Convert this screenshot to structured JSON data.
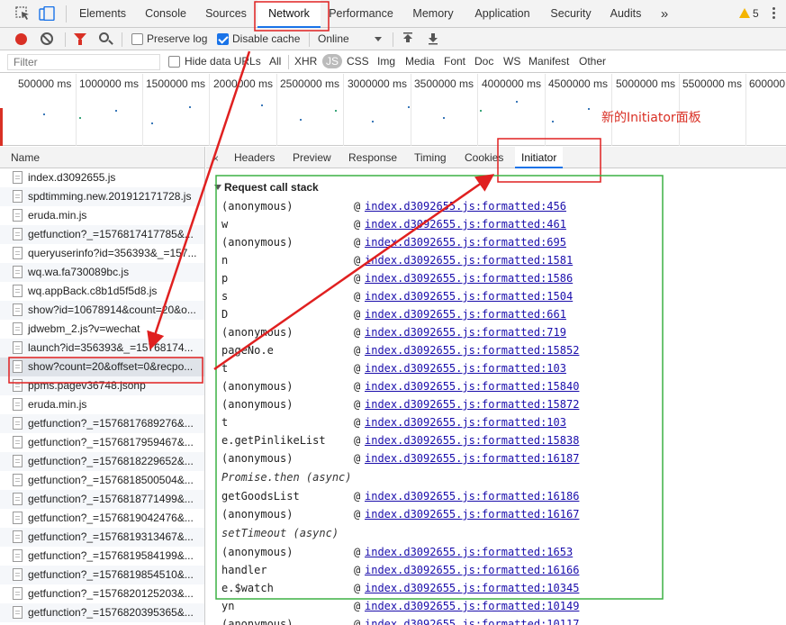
{
  "topbar": {
    "tabs": [
      "Elements",
      "Console",
      "Sources",
      "Network",
      "Performance",
      "Memory",
      "Application",
      "Security",
      "Audits"
    ],
    "active_tab": "Network",
    "more_label": "»",
    "warning_count": "5"
  },
  "toolbar": {
    "preserve_log_label": "Preserve log",
    "preserve_log_checked": false,
    "disable_cache_label": "Disable cache",
    "disable_cache_checked": true,
    "throttle_value": "Online"
  },
  "filterbar": {
    "placeholder": "Filter",
    "hide_data_urls_label": "Hide data URLs",
    "types": [
      "All",
      "XHR",
      "JS",
      "CSS",
      "Img",
      "Media",
      "Font",
      "Doc",
      "WS",
      "Manifest",
      "Other"
    ],
    "selected_type": "JS"
  },
  "timeline": {
    "ticks": [
      "500000 ms",
      "1000000 ms",
      "1500000 ms",
      "2000000 ms",
      "2500000 ms",
      "3000000 ms",
      "3500000 ms",
      "4000000 ms",
      "4500000 ms",
      "5000000 ms",
      "5500000 ms",
      "600000"
    ]
  },
  "annotation": {
    "text": "新的Initiator面板"
  },
  "requests": {
    "header": "Name",
    "selected_index": 10,
    "items": [
      "index.d3092655.js",
      "spdtimming.new.201912171728.js",
      "eruda.min.js",
      "getfunction?_=1576817417785&...",
      "queryuserinfo?id=356393&_=157...",
      "wq.wa.fa730089bc.js",
      "wq.appBack.c8b1d5f5d8.js",
      "show?id=10678914&count=20&o...",
      "jdwebm_2.js?v=wechat",
      "launch?id=356393&_=15768174...",
      "show?count=20&offset=0&recpo...",
      "ppms.pagev36748.jsonp",
      "eruda.min.js",
      "getfunction?_=1576817689276&...",
      "getfunction?_=1576817959467&...",
      "getfunction?_=1576818229652&...",
      "getfunction?_=1576818500504&...",
      "getfunction?_=1576818771499&...",
      "getfunction?_=1576819042476&...",
      "getfunction?_=1576819313467&...",
      "getfunction?_=1576819584199&...",
      "getfunction?_=1576819854510&...",
      "getfunction?_=1576820125203&...",
      "getfunction?_=1576820395365&..."
    ]
  },
  "detail": {
    "close_label": "×",
    "tabs": [
      "Headers",
      "Preview",
      "Response",
      "Timing",
      "Cookies",
      "Initiator"
    ],
    "active_tab": "Initiator",
    "stack_title": "Request call stack",
    "frames": [
      {
        "fn": "(anonymous)",
        "at": "@",
        "loc": "index.d3092655.js:formatted:456"
      },
      {
        "fn": "w",
        "at": "@",
        "loc": "index.d3092655.js:formatted:461"
      },
      {
        "fn": "(anonymous)",
        "at": "@",
        "loc": "index.d3092655.js:formatted:695"
      },
      {
        "fn": "n",
        "at": "@",
        "loc": "index.d3092655.js:formatted:1581"
      },
      {
        "fn": "p",
        "at": "@",
        "loc": "index.d3092655.js:formatted:1586"
      },
      {
        "fn": "s",
        "at": "@",
        "loc": "index.d3092655.js:formatted:1504"
      },
      {
        "fn": "D",
        "at": "@",
        "loc": "index.d3092655.js:formatted:661"
      },
      {
        "fn": "(anonymous)",
        "at": "@",
        "loc": "index.d3092655.js:formatted:719"
      },
      {
        "fn": "pageNo.e",
        "at": "@",
        "loc": "index.d3092655.js:formatted:15852"
      },
      {
        "fn": "t",
        "at": "@",
        "loc": "index.d3092655.js:formatted:103"
      },
      {
        "fn": "(anonymous)",
        "at": "@",
        "loc": "index.d3092655.js:formatted:15840"
      },
      {
        "fn": "(anonymous)",
        "at": "@",
        "loc": "index.d3092655.js:formatted:15872"
      },
      {
        "fn": "t",
        "at": "@",
        "loc": "index.d3092655.js:formatted:103"
      },
      {
        "fn": "e.getPinlikeList",
        "at": "@",
        "loc": "index.d3092655.js:formatted:15838"
      },
      {
        "fn": "(anonymous)",
        "at": "@",
        "loc": "index.d3092655.js:formatted:16187"
      },
      {
        "async": "Promise.then (async)"
      },
      {
        "fn": "getGoodsList",
        "at": "@",
        "loc": "index.d3092655.js:formatted:16186"
      },
      {
        "fn": "(anonymous)",
        "at": "@",
        "loc": "index.d3092655.js:formatted:16167"
      },
      {
        "async": "setTimeout (async)"
      },
      {
        "fn": "(anonymous)",
        "at": "@",
        "loc": "index.d3092655.js:formatted:1653"
      },
      {
        "fn": "handler",
        "at": "@",
        "loc": "index.d3092655.js:formatted:16166"
      },
      {
        "fn": "e.$watch",
        "at": "@",
        "loc": "index.d3092655.js:formatted:10345"
      },
      {
        "fn": "yn",
        "at": "@",
        "loc": "index.d3092655.js:formatted:10149"
      },
      {
        "fn": "(anonymous)",
        "at": "@",
        "loc": "index.d3092655.js:formatted:10117"
      }
    ]
  },
  "colors": {
    "accent": "#1a73e8",
    "record": "#d93025",
    "annotation_red": "#e02020",
    "annotation_green": "#3cb043",
    "link": "#1a0dab"
  }
}
